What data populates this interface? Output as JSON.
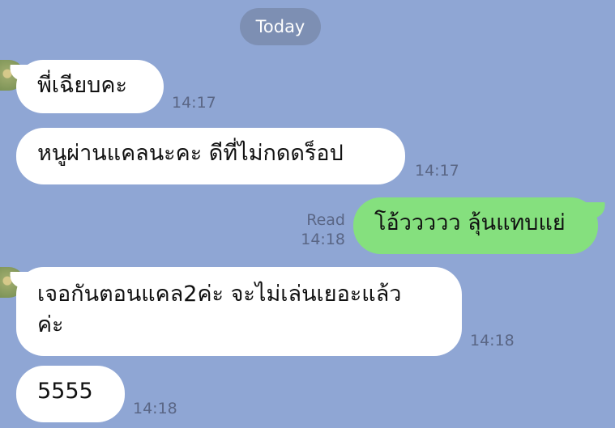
{
  "date_chip": "Today",
  "messages": [
    {
      "text": "พี่เฉียบคะ",
      "time": "14:17"
    },
    {
      "text": "หนูผ่านแคลนะคะ ดีที่ไม่กดดร็อป",
      "time": "14:17"
    },
    {
      "text": "โอ้ววววว ลุ้นแทบแย่",
      "read": "Read",
      "time": "14:18"
    },
    {
      "text_line1": "เจอกันตอนแคล2ค่ะ จะไม่เล่นเยอะแล้ว",
      "text_line2": "ค่ะ",
      "time": "14:18"
    },
    {
      "text": "5555",
      "time": "14:18"
    }
  ],
  "colors": {
    "chat_background": "#8fa6d4",
    "incoming_bubble": "#ffffff",
    "outgoing_bubble": "#85e07e",
    "date_chip": "#7d8fb3"
  }
}
